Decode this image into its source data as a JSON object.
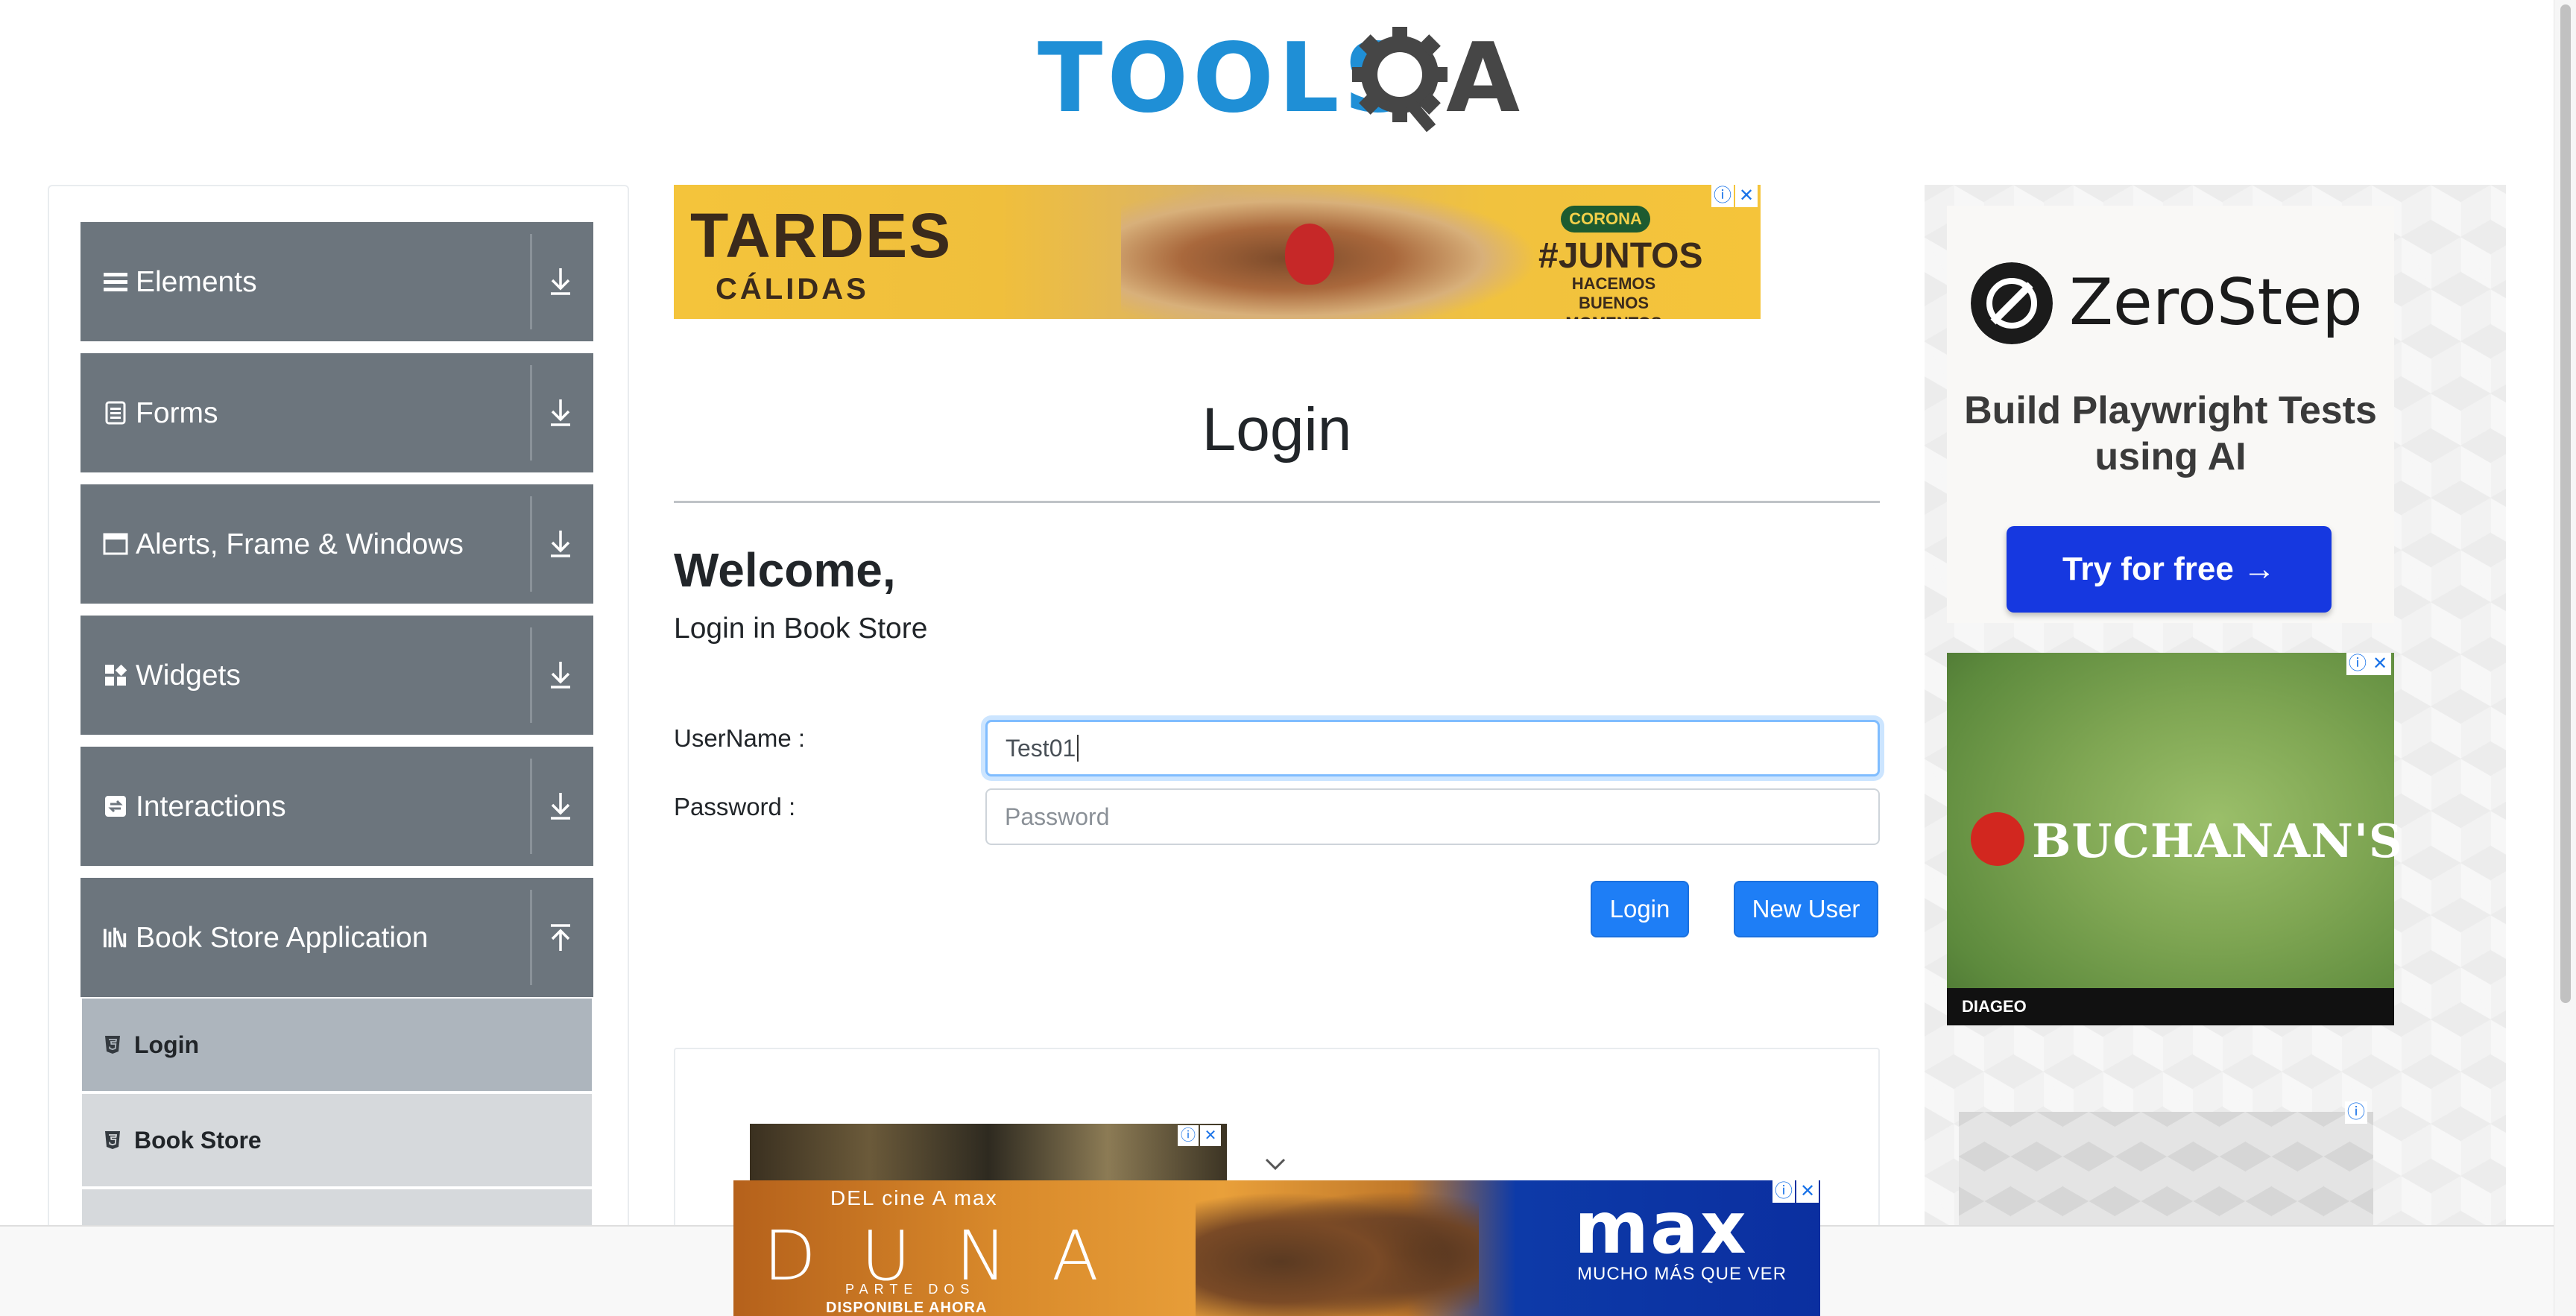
{
  "header": {
    "logo_text": "TOOLS",
    "logo_suffix": "A"
  },
  "sidebar": {
    "groups": [
      {
        "label": "Elements",
        "icon": "hamburger-icon",
        "expanded": false
      },
      {
        "label": "Forms",
        "icon": "document-icon",
        "expanded": false
      },
      {
        "label": "Alerts, Frame & Windows",
        "icon": "window-icon",
        "expanded": false
      },
      {
        "label": "Widgets",
        "icon": "grid-icon",
        "expanded": false
      },
      {
        "label": "Interactions",
        "icon": "sync-icon",
        "expanded": false
      },
      {
        "label": "Book Store Application",
        "icon": "books-icon",
        "expanded": true
      }
    ],
    "book_store_items": [
      {
        "label": "Login",
        "active": true
      },
      {
        "label": "Book Store",
        "active": false
      }
    ]
  },
  "ads": {
    "top_banner": {
      "headline": "TARDES",
      "subline": "CÁLIDAS",
      "brand": "CORONA",
      "hashtag": "#JUNTOS",
      "tagline": "HACEMOS BUENOS MOMENTOS"
    },
    "zerostep": {
      "brand": "ZeroStep",
      "tagline": "Build Playwright Tests using AI",
      "cta": "Try for free →"
    },
    "buchanans": {
      "brand": "BUCHANAN'S",
      "footer": "DIAGEO"
    },
    "bottom": {
      "pre": "DEL cine A max",
      "title": "DUNA",
      "subtitle": "PARTE DOS",
      "cta": "DISPONIBLE AHORA",
      "brand": "max",
      "brand_tagline": "MUCHO MÁS QUE VER"
    }
  },
  "main": {
    "title": "Login",
    "welcome": "Welcome,",
    "subtitle": "Login in Book Store",
    "username_label": "UserName :",
    "username_value": "Test01",
    "password_label": "Password :",
    "password_placeholder": "Password",
    "login_button": "Login",
    "new_user_button": "New User"
  },
  "colors": {
    "sidebar_group_bg": "#6c757d",
    "sidebar_active_bg": "#adb5bd",
    "primary_button": "#1e7ef6",
    "logo_blue": "#1f8fd6"
  }
}
